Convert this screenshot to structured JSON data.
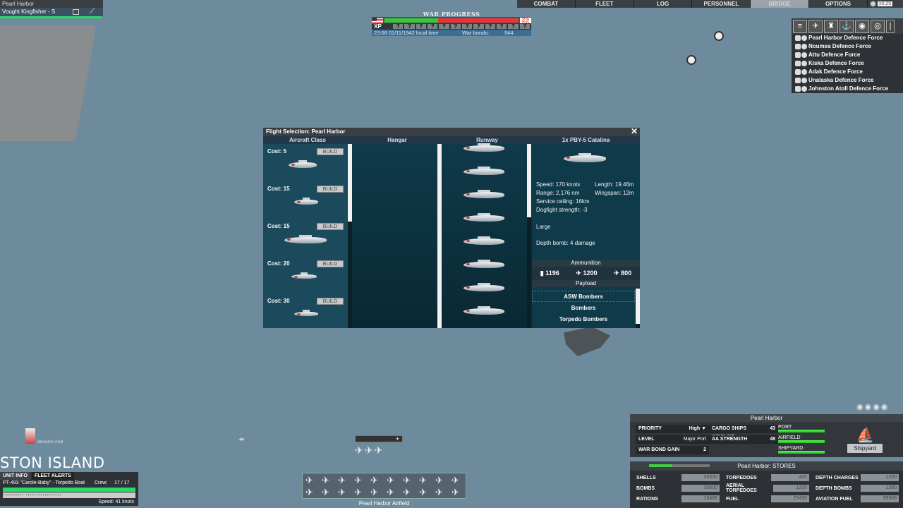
{
  "nav": {
    "tabs": [
      "COMBAT",
      "FLEET",
      "LOG",
      "PERSONNEL",
      "BRIDGE",
      "OPTIONS"
    ],
    "active_tab": "BRIDGE",
    "speed": "x0.25"
  },
  "top_left": {
    "location": "Pearl Harbor",
    "aircraft": "Vought Kingfisher - S"
  },
  "war_progress": {
    "title": "WAR PROGRESS",
    "us_share": 0.4,
    "xp_label": "XP",
    "xp_slots": [
      "?",
      "?",
      "?",
      "?",
      "?",
      "?",
      "?",
      "?",
      "?",
      "?",
      "?",
      "?"
    ],
    "time": "23:08 01/11/1942 local time",
    "bonds_label": "War bonds:",
    "bonds_value": "944"
  },
  "task_forces": [
    "Pearl Harbor Defence Force",
    "Noumea Defence Force",
    "Attu Defence Force",
    "Kiska Defence Force",
    "Adak Defence Force",
    "Unalaska Defence Force",
    "Johnston Atoll Defence Force"
  ],
  "dialog": {
    "title": "Flight Selection: Pearl Harbor",
    "close_icon": "close-icon",
    "headers": {
      "aircraft_class": "Aircraft Class",
      "hangar": "Hangar",
      "runway": "Runway",
      "selected": "1x PBY-5 Catalina"
    },
    "aircraft_classes": [
      {
        "cost": "Cost: 5",
        "build": "BUILD"
      },
      {
        "cost": "Cost: 15",
        "build": "BUILD"
      },
      {
        "cost": "Cost: 15",
        "build": "BUILD"
      },
      {
        "cost": "Cost: 20",
        "build": "BUILD"
      },
      {
        "cost": "Cost: 30",
        "build": "BUILD"
      }
    ],
    "runway_count": 8,
    "stats": {
      "speed": "Speed: 170 knots",
      "length": "Length: 19.46m",
      "range": "Range: 2,176 nm",
      "wingspan": "Wingspan: 12m",
      "ceiling": "Service ceiling: 16km",
      "dogfight": "Dogfight strength: -3",
      "size": "Large",
      "depth_bomb": "Depth bomb: 4 damage"
    },
    "ammunition": {
      "label": "Ammunition",
      "values": [
        "1196",
        "1200",
        "800"
      ]
    },
    "payload": {
      "label": "Payload",
      "options": [
        "ASW Bombers",
        "Bombers",
        "Torpedo Bombers"
      ]
    }
  },
  "map": {
    "island_label": "STON ISLAND",
    "atoll_label": "Johnston Atoll"
  },
  "unit_info": {
    "tabs": [
      "UNIT INFO",
      "FLEET ALERTS"
    ],
    "unit_name": "PT-493 \"Carole-Baby\" - Torpedo Boat",
    "crew_label": "Crew:",
    "crew_value": "17 / 17",
    "speed": "Speed: 41 knots"
  },
  "airfield": {
    "name": "Pearl Harbor Airfield"
  },
  "port": {
    "name": "Pearl Harbor",
    "priority_label": "PRIORITY",
    "priority_value": "High",
    "level_label": "LEVEL",
    "level_value": "Major Port",
    "bond_gain_label": "WAR BOND GAIN",
    "bond_gain_value": "2",
    "cargo_label": "CARGO SHIPS INBOUND",
    "cargo_value": "43",
    "aa_label": "AA STRENGTH",
    "aa_value": "48",
    "port_bar_label": "PORT",
    "airfield_bar_label": "AIRFIELD",
    "shipyard_bar_label": "SHIPYARD",
    "shipyard_button": "Shipyard"
  },
  "stores": {
    "title": "Pearl Harbor: STORES",
    "items": [
      {
        "label": "SHELLS",
        "value": "35500"
      },
      {
        "label": "TORPEDOES",
        "value": "400"
      },
      {
        "label": "DEPTH CHARGES",
        "value": "1200"
      },
      {
        "label": "BOMBS",
        "value": "35500"
      },
      {
        "label": "AERIAL TORPEDOES",
        "value": "1200"
      },
      {
        "label": "DEPTH BOMBS",
        "value": "1200"
      },
      {
        "label": "RATIONS",
        "value": "15486"
      },
      {
        "label": "FUEL",
        "value": "27436"
      },
      {
        "label": "AVIATION FUEL",
        "value": "39988"
      }
    ]
  }
}
